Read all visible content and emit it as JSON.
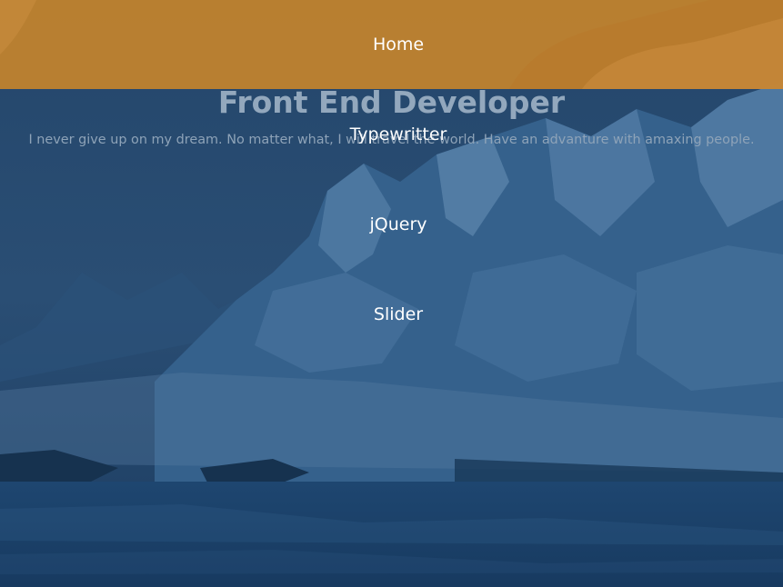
{
  "hero": {
    "title": "Front End Developer",
    "subtitle": "I never give up on my dream. No matter what, I will travel the world. Have an advanture with amaxing people."
  },
  "nav": {
    "items": [
      {
        "label": "Home",
        "active": true
      },
      {
        "label": "Typewritter",
        "active": false
      },
      {
        "label": "jQuery",
        "active": false
      },
      {
        "label": "Slider",
        "active": false
      }
    ]
  },
  "colors": {
    "nav_background": "#c4832c",
    "overlay_blue": "#1f4a78",
    "nav_text": "#ffffff",
    "hero_text": "#93a8bd"
  }
}
